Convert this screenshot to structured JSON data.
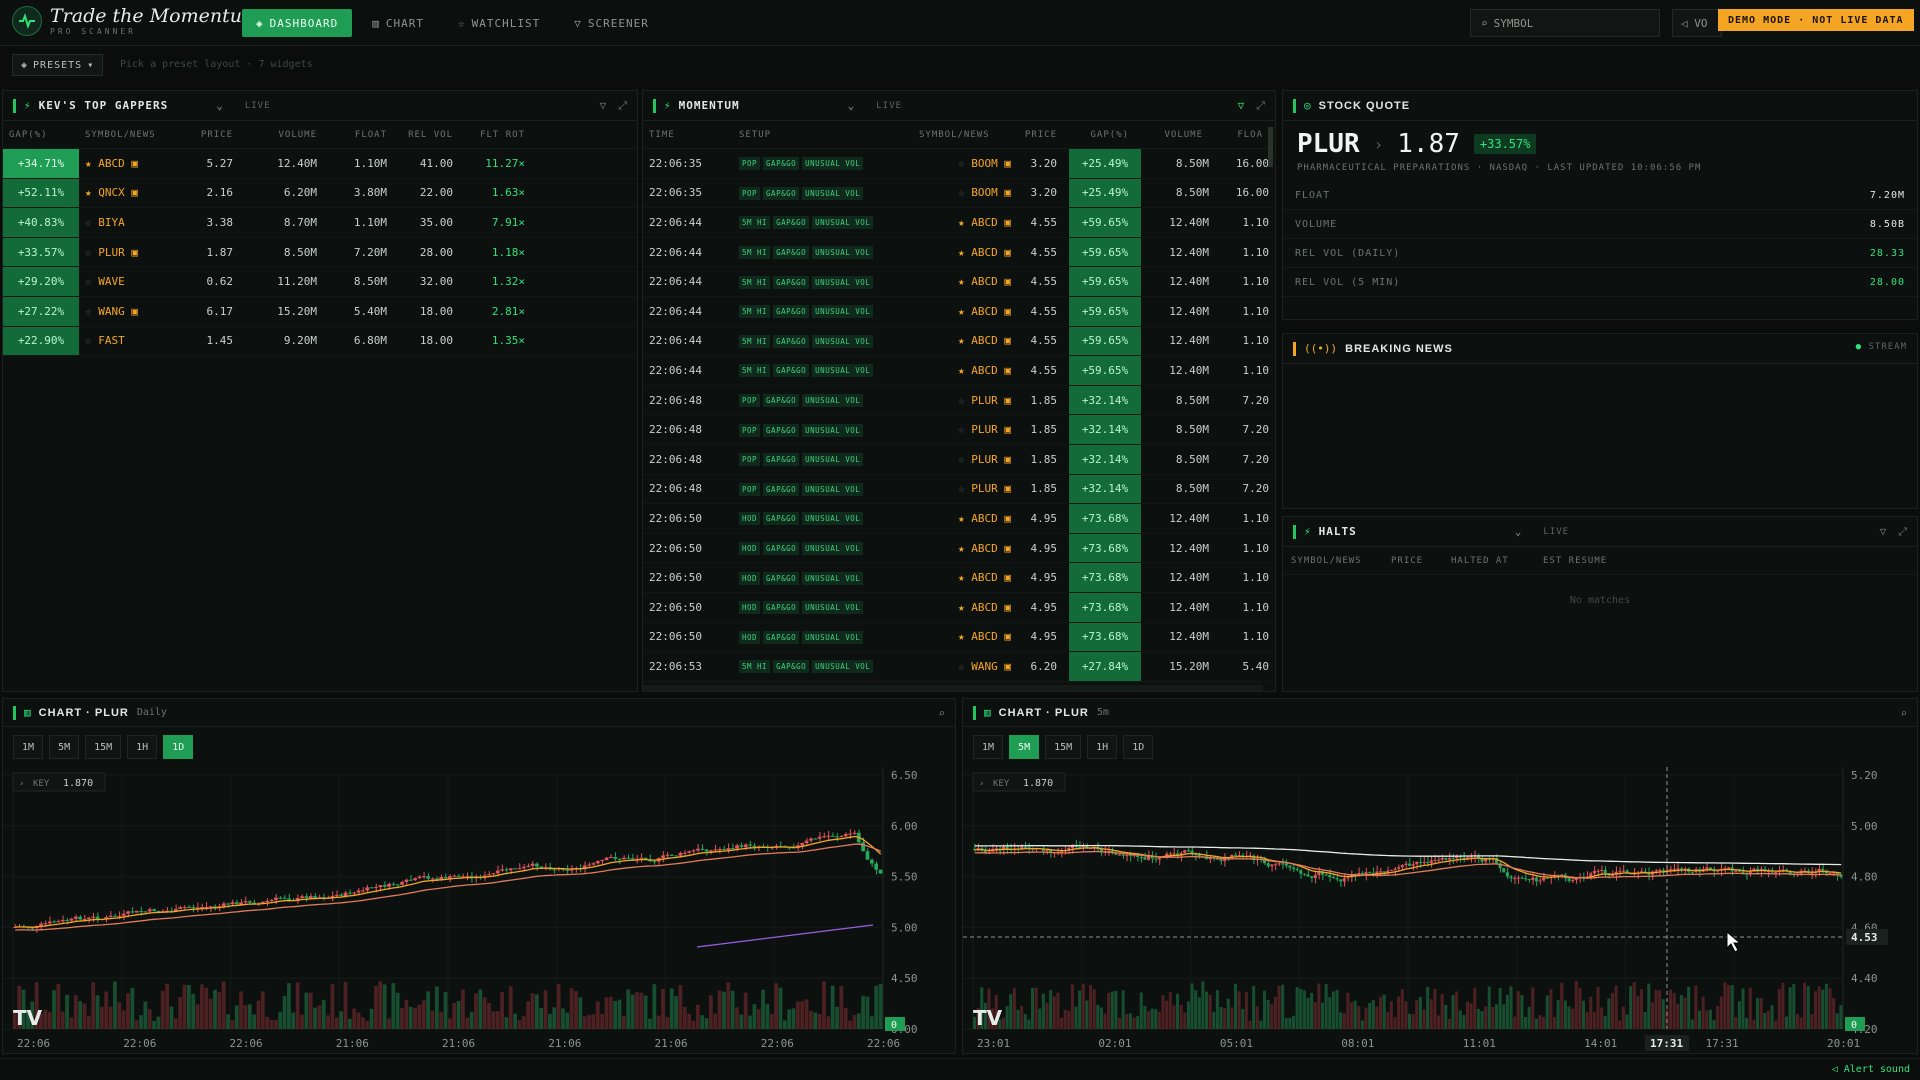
{
  "app": {
    "title": "Trade the Momentum",
    "subtitle": "PRO SCANNER"
  },
  "nav": [
    {
      "label": "DASHBOARD",
      "icon": "layers-icon",
      "active": true
    },
    {
      "label": "CHART",
      "icon": "bar-chart-icon",
      "active": false
    },
    {
      "label": "WATCHLIST",
      "icon": "star-icon",
      "active": false
    },
    {
      "label": "SCREENER",
      "icon": "filter-icon",
      "active": false
    }
  ],
  "search": {
    "placeholder": "SYMBOL"
  },
  "volume_label": "VO",
  "demo_badge": "DEMO MODE · NOT LIVE DATA",
  "presets": {
    "label": "PRESETS",
    "hint": "Pick a preset layout · 7 widgets"
  },
  "gappers": {
    "title": "KEV'S TOP GAPPERS",
    "status": "LIVE",
    "columns": [
      "GAP(%)",
      "SYMBOL/NEWS",
      "PRICE",
      "VOLUME",
      "FLOAT",
      "REL VOL",
      "FLT ROT"
    ],
    "rows": [
      {
        "gap": "+34.71%",
        "star": true,
        "symbol": "ABCD",
        "news": true,
        "price": "5.27",
        "volume": "12.40M",
        "float": "1.10M",
        "relvol": "41.00",
        "fltrot": "11.27×"
      },
      {
        "gap": "+52.11%",
        "star": true,
        "symbol": "QNCX",
        "news": true,
        "price": "2.16",
        "volume": "6.20M",
        "float": "3.80M",
        "relvol": "22.00",
        "fltrot": "1.63×"
      },
      {
        "gap": "+40.83%",
        "star": false,
        "symbol": "BIYA",
        "news": false,
        "price": "3.38",
        "volume": "8.70M",
        "float": "1.10M",
        "relvol": "35.00",
        "fltrot": "7.91×"
      },
      {
        "gap": "+33.57%",
        "star": false,
        "symbol": "PLUR",
        "news": true,
        "price": "1.87",
        "volume": "8.50M",
        "float": "7.20M",
        "relvol": "28.00",
        "fltrot": "1.18×"
      },
      {
        "gap": "+29.20%",
        "star": false,
        "symbol": "WAVE",
        "news": false,
        "price": "0.62",
        "volume": "11.20M",
        "float": "8.50M",
        "relvol": "32.00",
        "fltrot": "1.32×"
      },
      {
        "gap": "+27.22%",
        "star": false,
        "symbol": "WANG",
        "news": true,
        "price": "6.17",
        "volume": "15.20M",
        "float": "5.40M",
        "relvol": "18.00",
        "fltrot": "2.81×"
      },
      {
        "gap": "+22.90%",
        "star": false,
        "symbol": "FAST",
        "news": false,
        "price": "1.45",
        "volume": "9.20M",
        "float": "6.80M",
        "relvol": "18.00",
        "fltrot": "1.35×"
      }
    ]
  },
  "momentum": {
    "title": "MOMENTUM",
    "status": "LIVE",
    "columns": [
      "TIME",
      "SETUP",
      "SYMBOL/NEWS",
      "PRICE",
      "GAP(%)",
      "VOLUME",
      "FLOA"
    ],
    "rows": [
      {
        "time": "22:06:35",
        "tags": [
          "POP",
          "GAP&GO",
          "UNUSUAL VOL"
        ],
        "star": false,
        "symbol": "BOOM",
        "price": "3.20",
        "gap": "+25.49%",
        "volume": "8.50M",
        "float": "16.00"
      },
      {
        "time": "22:06:35",
        "tags": [
          "POP",
          "GAP&GO",
          "UNUSUAL VOL"
        ],
        "star": false,
        "symbol": "BOOM",
        "price": "3.20",
        "gap": "+25.49%",
        "volume": "8.50M",
        "float": "16.00"
      },
      {
        "time": "22:06:44",
        "tags": [
          "5M HI",
          "GAP&GO",
          "UNUSUAL VOL"
        ],
        "star": true,
        "symbol": "ABCD",
        "price": "4.55",
        "gap": "+59.65%",
        "volume": "12.40M",
        "float": "1.10"
      },
      {
        "time": "22:06:44",
        "tags": [
          "5M HI",
          "GAP&GO",
          "UNUSUAL VOL"
        ],
        "star": true,
        "symbol": "ABCD",
        "price": "4.55",
        "gap": "+59.65%",
        "volume": "12.40M",
        "float": "1.10"
      },
      {
        "time": "22:06:44",
        "tags": [
          "5M HI",
          "GAP&GO",
          "UNUSUAL VOL"
        ],
        "star": true,
        "symbol": "ABCD",
        "price": "4.55",
        "gap": "+59.65%",
        "volume": "12.40M",
        "float": "1.10"
      },
      {
        "time": "22:06:44",
        "tags": [
          "5M HI",
          "GAP&GO",
          "UNUSUAL VOL"
        ],
        "star": true,
        "symbol": "ABCD",
        "price": "4.55",
        "gap": "+59.65%",
        "volume": "12.40M",
        "float": "1.10"
      },
      {
        "time": "22:06:44",
        "tags": [
          "5M HI",
          "GAP&GO",
          "UNUSUAL VOL"
        ],
        "star": true,
        "symbol": "ABCD",
        "price": "4.55",
        "gap": "+59.65%",
        "volume": "12.40M",
        "float": "1.10"
      },
      {
        "time": "22:06:44",
        "tags": [
          "5M HI",
          "GAP&GO",
          "UNUSUAL VOL"
        ],
        "star": true,
        "symbol": "ABCD",
        "price": "4.55",
        "gap": "+59.65%",
        "volume": "12.40M",
        "float": "1.10"
      },
      {
        "time": "22:06:48",
        "tags": [
          "POP",
          "GAP&GO",
          "UNUSUAL VOL"
        ],
        "star": false,
        "symbol": "PLUR",
        "price": "1.85",
        "gap": "+32.14%",
        "volume": "8.50M",
        "float": "7.20"
      },
      {
        "time": "22:06:48",
        "tags": [
          "POP",
          "GAP&GO",
          "UNUSUAL VOL"
        ],
        "star": false,
        "symbol": "PLUR",
        "price": "1.85",
        "gap": "+32.14%",
        "volume": "8.50M",
        "float": "7.20"
      },
      {
        "time": "22:06:48",
        "tags": [
          "POP",
          "GAP&GO",
          "UNUSUAL VOL"
        ],
        "star": false,
        "symbol": "PLUR",
        "price": "1.85",
        "gap": "+32.14%",
        "volume": "8.50M",
        "float": "7.20"
      },
      {
        "time": "22:06:48",
        "tags": [
          "POP",
          "GAP&GO",
          "UNUSUAL VOL"
        ],
        "star": false,
        "symbol": "PLUR",
        "price": "1.85",
        "gap": "+32.14%",
        "volume": "8.50M",
        "float": "7.20"
      },
      {
        "time": "22:06:50",
        "tags": [
          "HOD",
          "GAP&GO",
          "UNUSUAL VOL"
        ],
        "star": true,
        "symbol": "ABCD",
        "price": "4.95",
        "gap": "+73.68%",
        "volume": "12.40M",
        "float": "1.10"
      },
      {
        "time": "22:06:50",
        "tags": [
          "HOD",
          "GAP&GO",
          "UNUSUAL VOL"
        ],
        "star": true,
        "symbol": "ABCD",
        "price": "4.95",
        "gap": "+73.68%",
        "volume": "12.40M",
        "float": "1.10"
      },
      {
        "time": "22:06:50",
        "tags": [
          "HOD",
          "GAP&GO",
          "UNUSUAL VOL"
        ],
        "star": true,
        "symbol": "ABCD",
        "price": "4.95",
        "gap": "+73.68%",
        "volume": "12.40M",
        "float": "1.10"
      },
      {
        "time": "22:06:50",
        "tags": [
          "HOD",
          "GAP&GO",
          "UNUSUAL VOL"
        ],
        "star": true,
        "symbol": "ABCD",
        "price": "4.95",
        "gap": "+73.68%",
        "volume": "12.40M",
        "float": "1.10"
      },
      {
        "time": "22:06:50",
        "tags": [
          "HOD",
          "GAP&GO",
          "UNUSUAL VOL"
        ],
        "star": true,
        "symbol": "ABCD",
        "price": "4.95",
        "gap": "+73.68%",
        "volume": "12.40M",
        "float": "1.10"
      },
      {
        "time": "22:06:53",
        "tags": [
          "5M HI",
          "GAP&GO",
          "UNUSUAL VOL"
        ],
        "star": false,
        "symbol": "WANG",
        "price": "6.20",
        "gap": "+27.84%",
        "volume": "15.20M",
        "float": "5.40"
      }
    ]
  },
  "quote": {
    "title": "STOCK QUOTE",
    "symbol": "PLUR",
    "price": "1.87",
    "change": "+33.57%",
    "meta": "PHARMACEUTICAL PREPARATIONS · NASDAQ · LAST UPDATED 10:06:56 PM",
    "stats": [
      {
        "label": "FLOAT",
        "value": "7.20M",
        "green": false
      },
      {
        "label": "VOLUME",
        "value": "8.50B",
        "green": false
      },
      {
        "label": "REL VOL (DAILY)",
        "value": "28.33",
        "green": true
      },
      {
        "label": "REL VOL (5 MIN)",
        "value": "28.00",
        "green": true
      }
    ]
  },
  "news": {
    "title": "BREAKING NEWS",
    "stream": "STREAM"
  },
  "halts": {
    "title": "HALTS",
    "status": "LIVE",
    "columns": [
      "SYMBOL/NEWS",
      "PRICE",
      "HALTED AT",
      "EST RESUME"
    ],
    "empty": "No matches"
  },
  "chart_daily": {
    "title": "CHART · PLUR",
    "interval": "Daily",
    "timeframes": [
      "1M",
      "5M",
      "15M",
      "1H",
      "1D"
    ],
    "active_tf": "1D",
    "key_label": "KEY",
    "key_value": "1.870",
    "y_ticks": [
      "6.50",
      "6.00",
      "5.50",
      "5.00",
      "4.50",
      "0.00"
    ],
    "x_ticks": [
      "22:06",
      "22:06",
      "22:06",
      "21:06",
      "21:06",
      "21:06",
      "21:06",
      "22:06",
      "22:06"
    ],
    "zero_badge": "0"
  },
  "chart_5m": {
    "title": "CHART · PLUR",
    "interval": "5m",
    "timeframes": [
      "1M",
      "5M",
      "15M",
      "1H",
      "1D"
    ],
    "active_tf": "5M",
    "key_label": "KEY",
    "key_value": "1.870",
    "y_ticks": [
      "5.20",
      "5.00",
      "4.80",
      "4.60",
      "4.40",
      "4.20"
    ],
    "x_ticks": [
      "23:01",
      "02:01",
      "05:01",
      "08:01",
      "11:01",
      "14:01",
      "17:31",
      "20:01"
    ],
    "crosshair_price": "4.53",
    "crosshair_time": "17:31",
    "zero_badge": "0"
  },
  "footer": {
    "alert": "Alert sound"
  },
  "colors": {
    "accent": "#1f9d55",
    "up": "#2fe37a",
    "warn": "#f5a524",
    "bg": "#0a0d0c"
  }
}
